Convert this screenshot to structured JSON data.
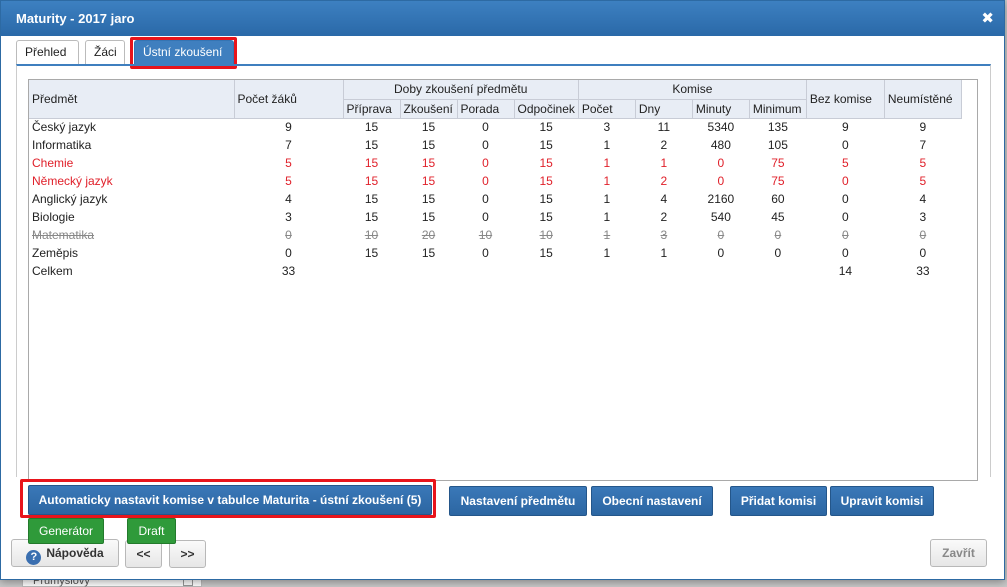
{
  "dialog": {
    "title": "Maturity - 2017 jaro",
    "close_symbol": "✖"
  },
  "tabs": [
    {
      "label": "Přehled"
    },
    {
      "label": "Žáci"
    },
    {
      "label": "Ústní zkoušení"
    }
  ],
  "table": {
    "headers": {
      "subject": "Předmět",
      "student_count": "Počet žáků",
      "durations_group": "Doby zkoušení předmětu",
      "prep": "Příprava",
      "exam": "Zkoušení",
      "meeting": "Porada",
      "rest": "Odpočinek",
      "committee_group": "Komise",
      "count": "Počet",
      "days": "Dny",
      "minutes": "Minuty",
      "minimum": "Minimum",
      "no_committee": "Bez komise",
      "unplaced": "Neumístěné"
    },
    "rows": [
      {
        "subject": "Český jazyk",
        "students": "9",
        "prep": "15",
        "exam": "15",
        "meeting": "0",
        "rest": "15",
        "count": "3",
        "days": "11",
        "minutes": "5340",
        "minimum": "135",
        "no_committee": "9",
        "unplaced": "9",
        "style": "normal"
      },
      {
        "subject": "Informatika",
        "students": "7",
        "prep": "15",
        "exam": "15",
        "meeting": "0",
        "rest": "15",
        "count": "1",
        "days": "2",
        "minutes": "480",
        "minimum": "105",
        "no_committee": "0",
        "unplaced": "7",
        "style": "normal"
      },
      {
        "subject": "Chemie",
        "students": "5",
        "prep": "15",
        "exam": "15",
        "meeting": "0",
        "rest": "15",
        "count": "1",
        "days": "1",
        "minutes": "0",
        "minimum": "75",
        "no_committee": "5",
        "unplaced": "5",
        "style": "red"
      },
      {
        "subject": "Německý jazyk",
        "students": "5",
        "prep": "15",
        "exam": "15",
        "meeting": "0",
        "rest": "15",
        "count": "1",
        "days": "2",
        "minutes": "0",
        "minimum": "75",
        "no_committee": "0",
        "unplaced": "5",
        "style": "red"
      },
      {
        "subject": "Anglický jazyk",
        "students": "4",
        "prep": "15",
        "exam": "15",
        "meeting": "0",
        "rest": "15",
        "count": "1",
        "days": "4",
        "minutes": "2160",
        "minimum": "60",
        "no_committee": "0",
        "unplaced": "4",
        "style": "normal"
      },
      {
        "subject": "Biologie",
        "students": "3",
        "prep": "15",
        "exam": "15",
        "meeting": "0",
        "rest": "15",
        "count": "1",
        "days": "2",
        "minutes": "540",
        "minimum": "45",
        "no_committee": "0",
        "unplaced": "3",
        "style": "normal"
      },
      {
        "subject": "Matematika",
        "students": "0",
        "prep": "10",
        "exam": "20",
        "meeting": "10",
        "rest": "10",
        "count": "1",
        "days": "3",
        "minutes": "0",
        "minimum": "0",
        "no_committee": "0",
        "unplaced": "0",
        "style": "strike"
      },
      {
        "subject": "Zeměpis",
        "students": "0",
        "prep": "15",
        "exam": "15",
        "meeting": "0",
        "rest": "15",
        "count": "1",
        "days": "1",
        "minutes": "0",
        "minimum": "0",
        "no_committee": "0",
        "unplaced": "0",
        "style": "normal"
      }
    ],
    "total": {
      "label": "Celkem",
      "students": "33",
      "no_committee": "14",
      "unplaced": "33"
    }
  },
  "actions": {
    "auto_assign": "Automaticky nastavit komise v tabulce Maturita - ústní zkoušení (5)",
    "subject_settings": "Nastavení předmětu",
    "general_settings": "Obecní nastavení",
    "add_committee": "Přidat komisi",
    "edit_committee": "Upravit komisi",
    "generator": "Generátor",
    "draft": "Draft",
    "help": "Nápověda",
    "prev": "<<",
    "next": ">>",
    "close": "Zavřít"
  },
  "backdrop": {
    "fragment_text": "Průmyslový"
  },
  "colors": {
    "titlebar": "#2f6fae",
    "accent": "#3f7fbf",
    "error_text": "#e0202a",
    "highlight": "#e8141b",
    "green": "#2f9a3a"
  }
}
